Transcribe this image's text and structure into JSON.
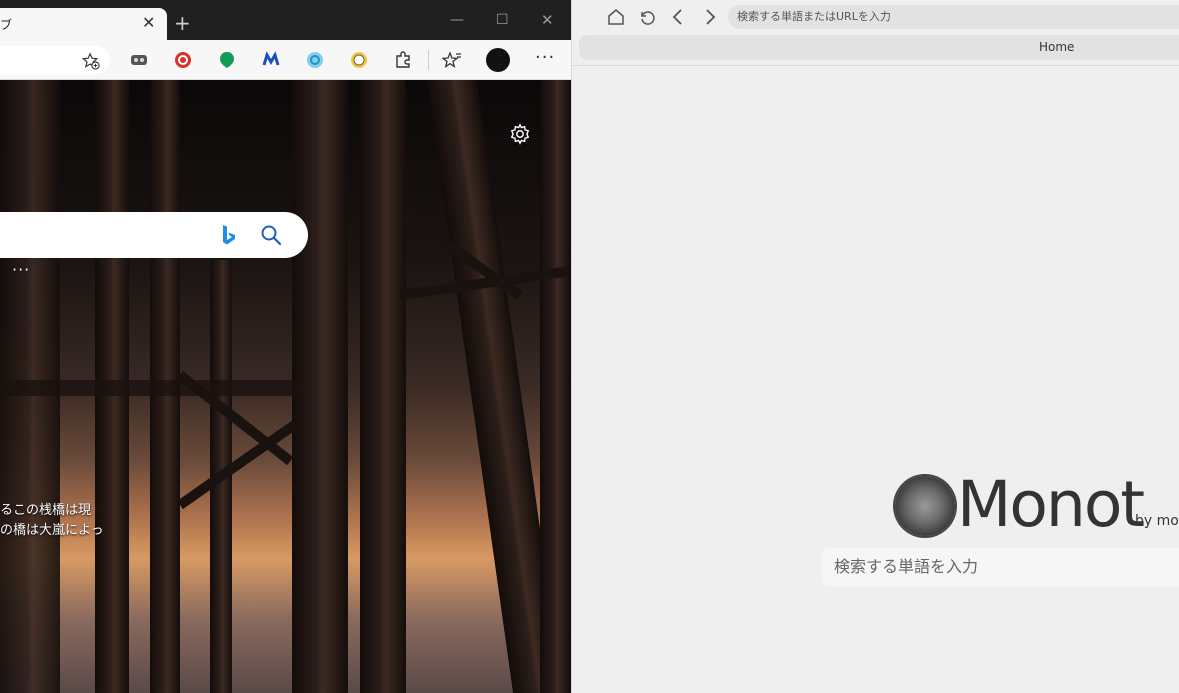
{
  "edge": {
    "tab": {
      "title": "ブ",
      "close_glyph": "✕"
    },
    "new_tab_glyph": "+",
    "window_controls": {
      "minimize": "—",
      "maximize": "☐",
      "close": "✕"
    },
    "toolbar": {
      "more_glyph": "···",
      "extensions": [
        "glasses-extension",
        "red-circle-extension",
        "green-extension",
        "m-extension",
        "blue-circle-extension",
        "yellow-extension",
        "extensions-puzzle",
        "favorites"
      ]
    },
    "ntp": {
      "more_dots": "···",
      "caption_line1": "るこの桟橋は現",
      "caption_line2": "の橋は大嵐によっ"
    }
  },
  "monot": {
    "url_placeholder": "検索する単語またはURLを入力",
    "tab_label": "Home",
    "logo_text": "Monot",
    "logo_by": "by monot",
    "search_placeholder": "検索する単語を入力"
  }
}
